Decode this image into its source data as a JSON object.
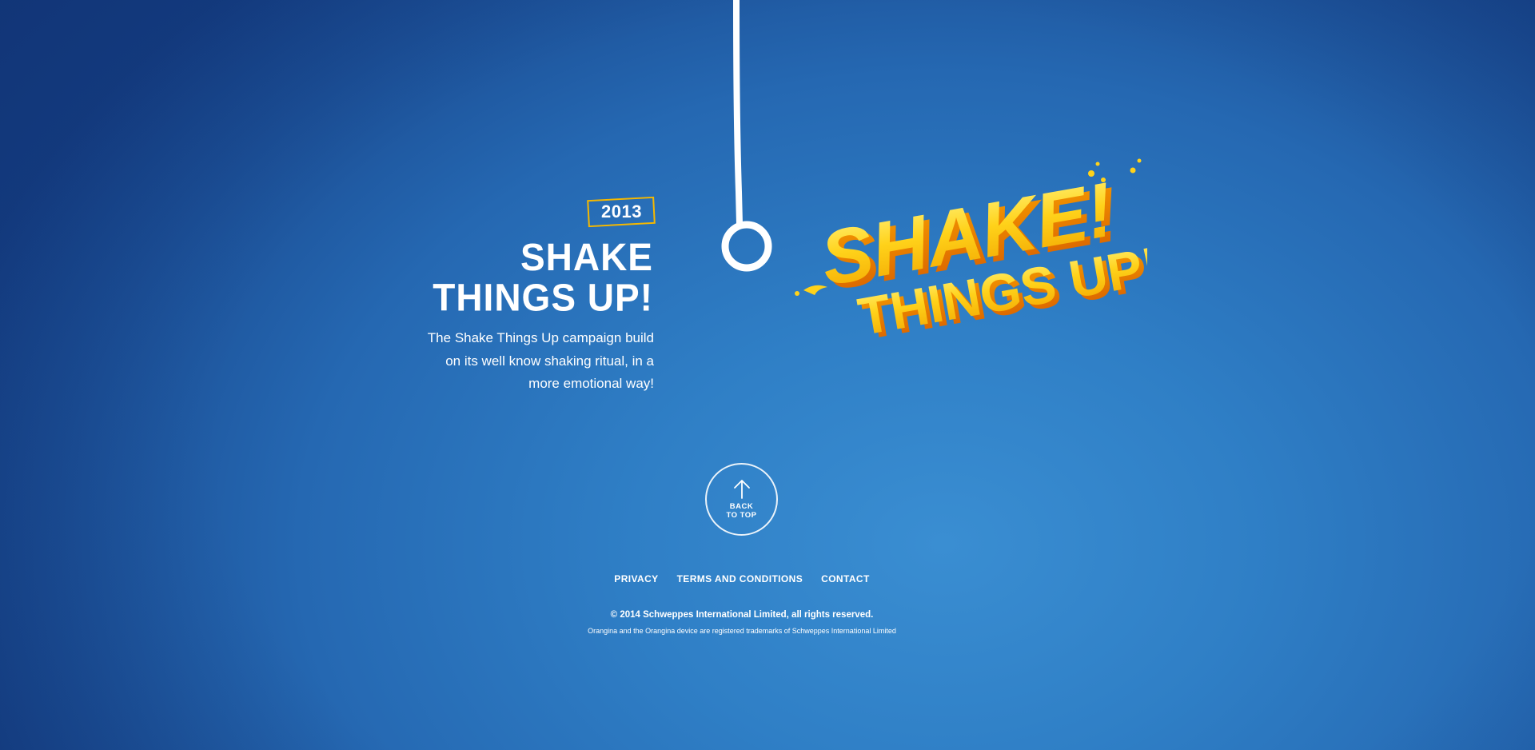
{
  "milestone": {
    "year": "2013",
    "headline_line1": "SHAKE",
    "headline_line2": "THINGS UP!",
    "description": "The Shake Things Up campaign build on its well know shaking ritual, in a more emotional way!",
    "logo_line1": "SHAKE!",
    "logo_line2": "THINGS UP!",
    "accent_color": "#f5b800"
  },
  "back_to_top": {
    "line1": "BACK",
    "line2": "TO TOP",
    "icon": "arrow-up-icon"
  },
  "footer": {
    "links": [
      "PRIVACY",
      "TERMS AND CONDITIONS",
      "CONTACT"
    ],
    "copyright": "© 2014 Schweppes International Limited, all rights reserved.",
    "trademark": "Orangina and the Orangina device are registered trademarks of Schweppes International Limited"
  },
  "colors": {
    "background": "#2a70b8",
    "text": "#ffffff",
    "logo_yellow": "#ffd21a",
    "logo_orange": "#f08a00"
  }
}
